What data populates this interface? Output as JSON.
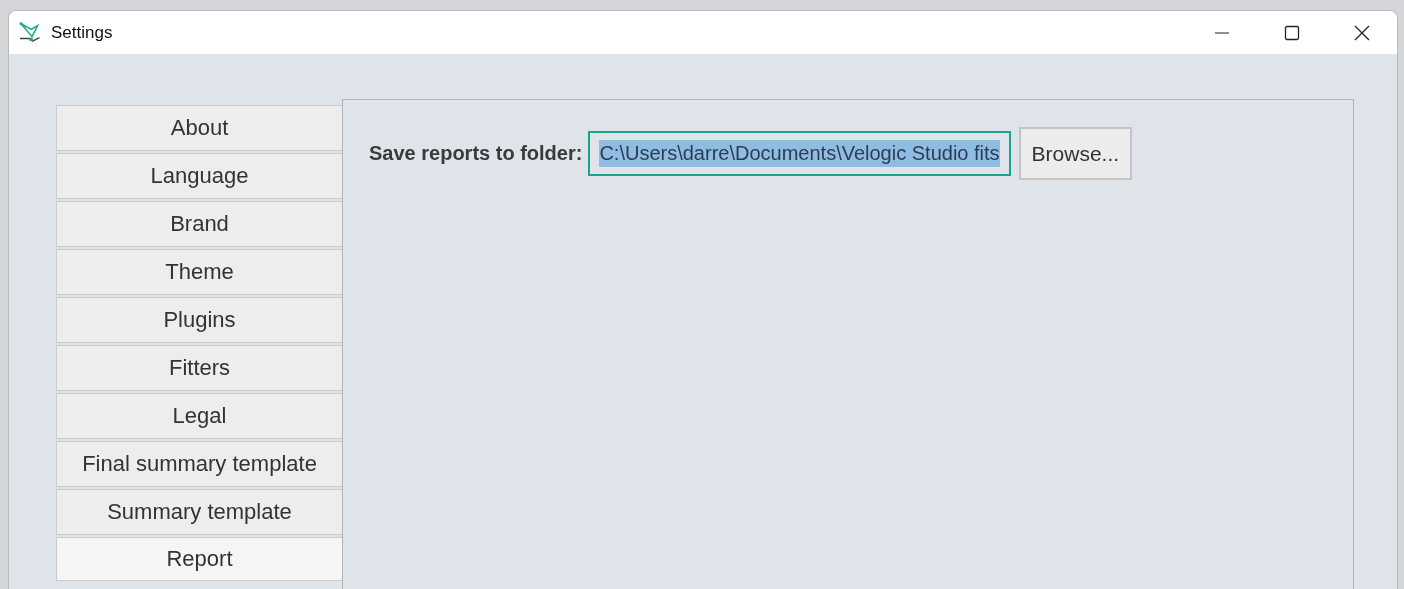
{
  "window": {
    "title": "Settings"
  },
  "sidebar": {
    "items": [
      {
        "label": "About",
        "selected": false
      },
      {
        "label": "Language",
        "selected": false
      },
      {
        "label": "Brand",
        "selected": false
      },
      {
        "label": "Theme",
        "selected": false
      },
      {
        "label": "Plugins",
        "selected": false
      },
      {
        "label": "Fitters",
        "selected": false
      },
      {
        "label": "Legal",
        "selected": false
      },
      {
        "label": "Final summary template",
        "selected": false
      },
      {
        "label": "Summary template",
        "selected": false
      },
      {
        "label": "Report",
        "selected": true
      }
    ]
  },
  "report": {
    "folder_label": "Save reports to folder:",
    "folder_value": "C:\\Users\\darre\\Documents\\Velogic Studio fits",
    "text_selected": true,
    "browse_button": "Browse..."
  }
}
